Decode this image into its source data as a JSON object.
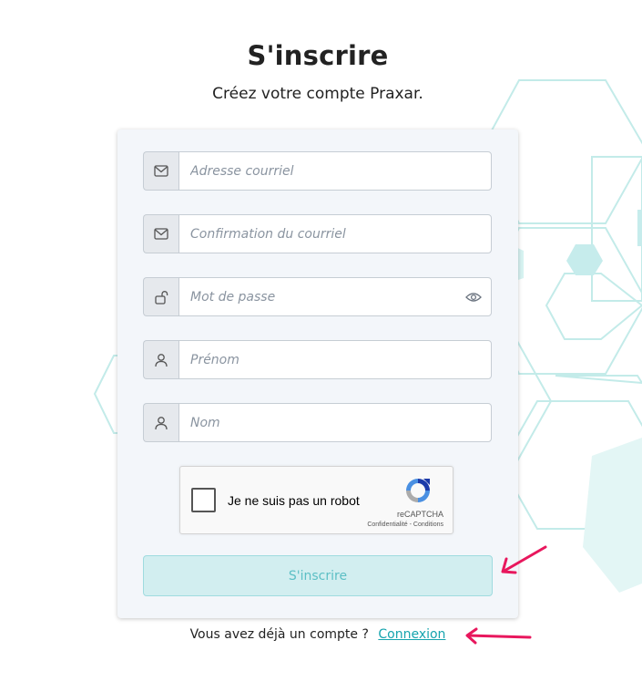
{
  "header": {
    "title": "S'inscrire",
    "subtitle": "Créez votre compte Praxar."
  },
  "form": {
    "email": {
      "placeholder": "Adresse courriel",
      "icon": "envelope-icon"
    },
    "email_confirm": {
      "placeholder": "Confirmation du courriel",
      "icon": "envelope-icon"
    },
    "password": {
      "placeholder": "Mot de passe",
      "icon": "unlock-icon",
      "toggle_icon": "eye-icon"
    },
    "first_name": {
      "placeholder": "Prénom",
      "icon": "user-icon"
    },
    "last_name": {
      "placeholder": "Nom",
      "icon": "user-icon"
    },
    "submit_label": "S'inscrire"
  },
  "captcha": {
    "label": "Je ne suis pas un robot",
    "brand": "reCAPTCHA",
    "terms": "Confidentialité - Conditions"
  },
  "footer": {
    "text": "Vous avez déjà un compte ?",
    "link": "Connexion"
  },
  "colors": {
    "accent": "#16a4ae",
    "button_bg": "#d2eef0",
    "annotation_arrow": "#e8175d",
    "hex_pattern": "#bfe8e8"
  }
}
